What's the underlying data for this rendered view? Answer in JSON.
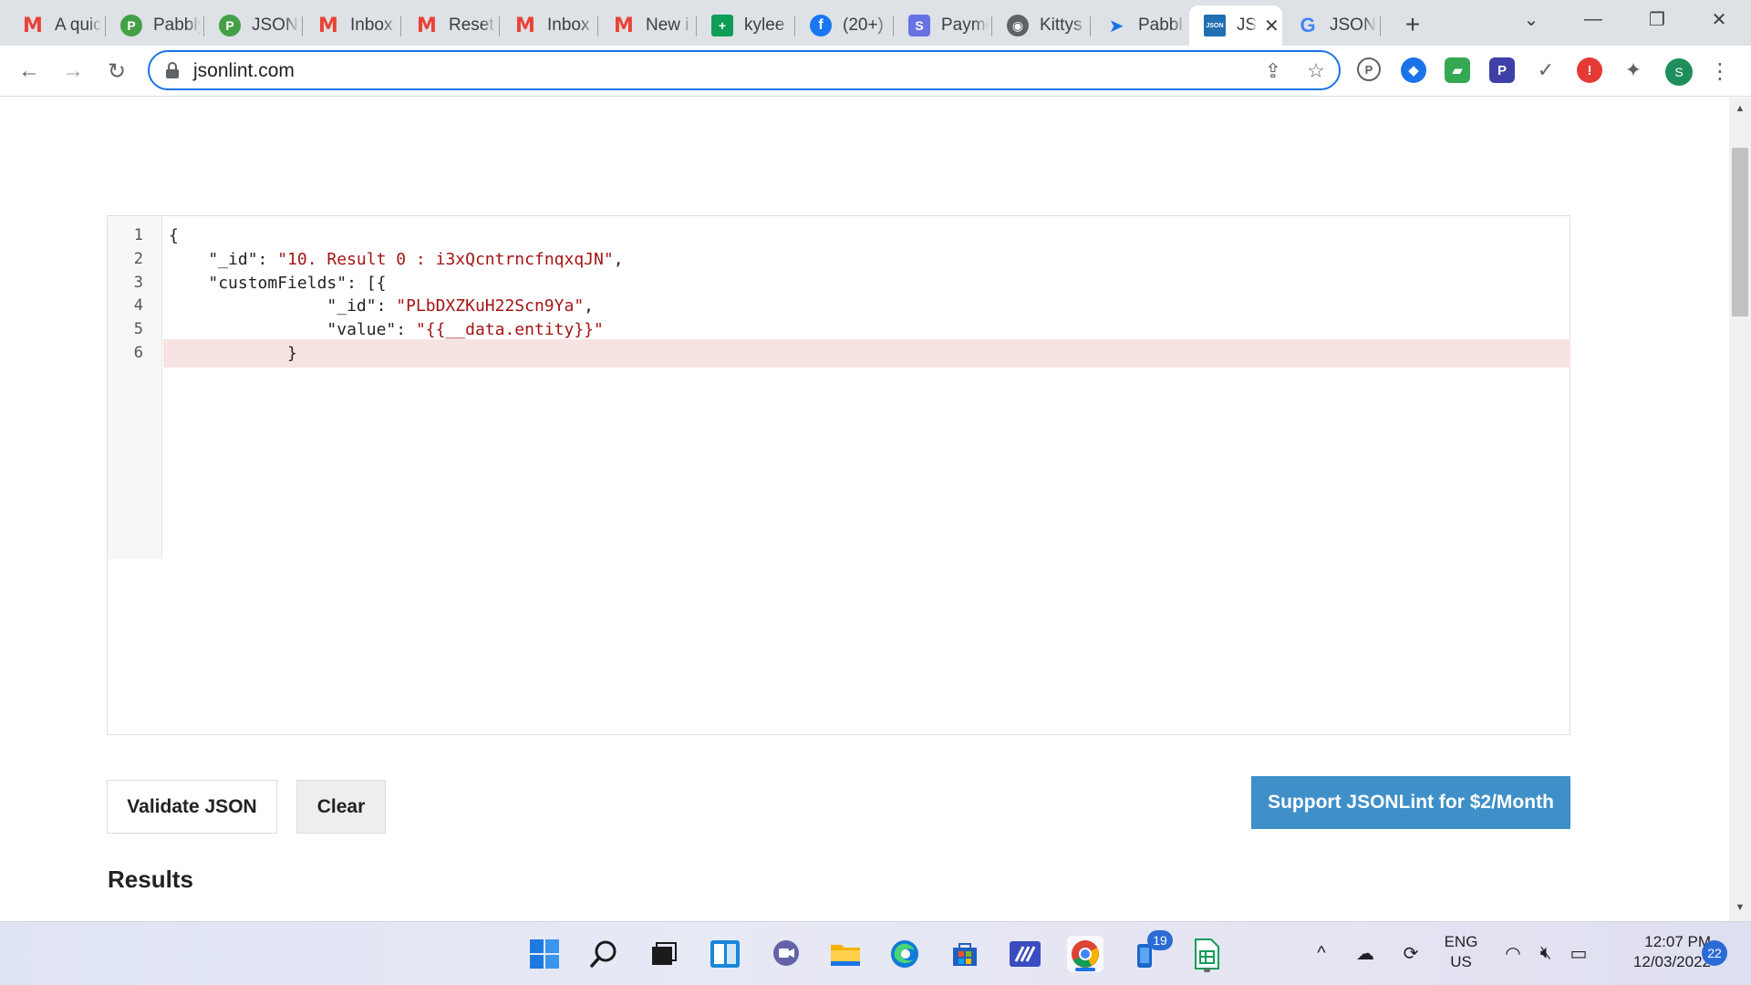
{
  "browser": {
    "tabs": [
      {
        "label": "A quic",
        "icon": "gmail-icon"
      },
      {
        "label": "Pabbly",
        "icon": "pabbly-icon"
      },
      {
        "label": "JSON",
        "icon": "pabbly-icon"
      },
      {
        "label": "Inbox",
        "icon": "gmail-icon"
      },
      {
        "label": "Reset",
        "icon": "gmail-icon"
      },
      {
        "label": "Inbox",
        "icon": "gmail-icon"
      },
      {
        "label": "New i",
        "icon": "gmail-icon"
      },
      {
        "label": "kylee",
        "icon": "sheets-icon"
      },
      {
        "label": "(20+)",
        "icon": "facebook-icon"
      },
      {
        "label": "Payme",
        "icon": "s-app-icon"
      },
      {
        "label": "Kittys",
        "icon": "globe-icon"
      },
      {
        "label": "Pabbl",
        "icon": "arrow-icon"
      },
      {
        "label": "JS",
        "icon": "jsonlint-icon",
        "active": true
      },
      {
        "label": "JSON",
        "icon": "google-icon"
      }
    ],
    "address_bar": {
      "url": "jsonlint.com"
    },
    "profile_initial": "S"
  },
  "editor": {
    "line_numbers": [
      "1",
      "2",
      "3",
      "4",
      "5",
      "6"
    ],
    "lines": [
      {
        "indent": "",
        "key": "",
        "text": "{",
        "string": ""
      },
      {
        "indent": "    ",
        "key": "\"_id\": ",
        "string": "\"10. Result 0 : i3xQcntrncfnqxqJN\"",
        "text": ","
      },
      {
        "indent": "    ",
        "key": "\"customFields\": [{",
        "string": "",
        "text": ""
      },
      {
        "indent": "                ",
        "key": "\"_id\": ",
        "string": "\"PLbDXZKuH22Scn9Ya\"",
        "text": ","
      },
      {
        "indent": "                ",
        "key": "\"value\": ",
        "string": "\"{{__data.entity}}\"",
        "text": ""
      },
      {
        "indent": "            ",
        "key": "",
        "text": "}",
        "string": ""
      }
    ],
    "error_line": 6
  },
  "buttons": {
    "validate": "Validate JSON",
    "clear": "Clear",
    "support": "Support JSONLint for $2/Month"
  },
  "results_heading": "Results",
  "taskbar": {
    "badge_count": "19",
    "language": [
      "ENG",
      "US"
    ],
    "time": "12:07 PM",
    "date": "12/03/2022",
    "notification_count": "22"
  },
  "colors": {
    "accent": "#1a73e8",
    "support_button": "#3f8fc8",
    "error_highlight": "#f8e3e3",
    "string_literal": "#a31515"
  }
}
